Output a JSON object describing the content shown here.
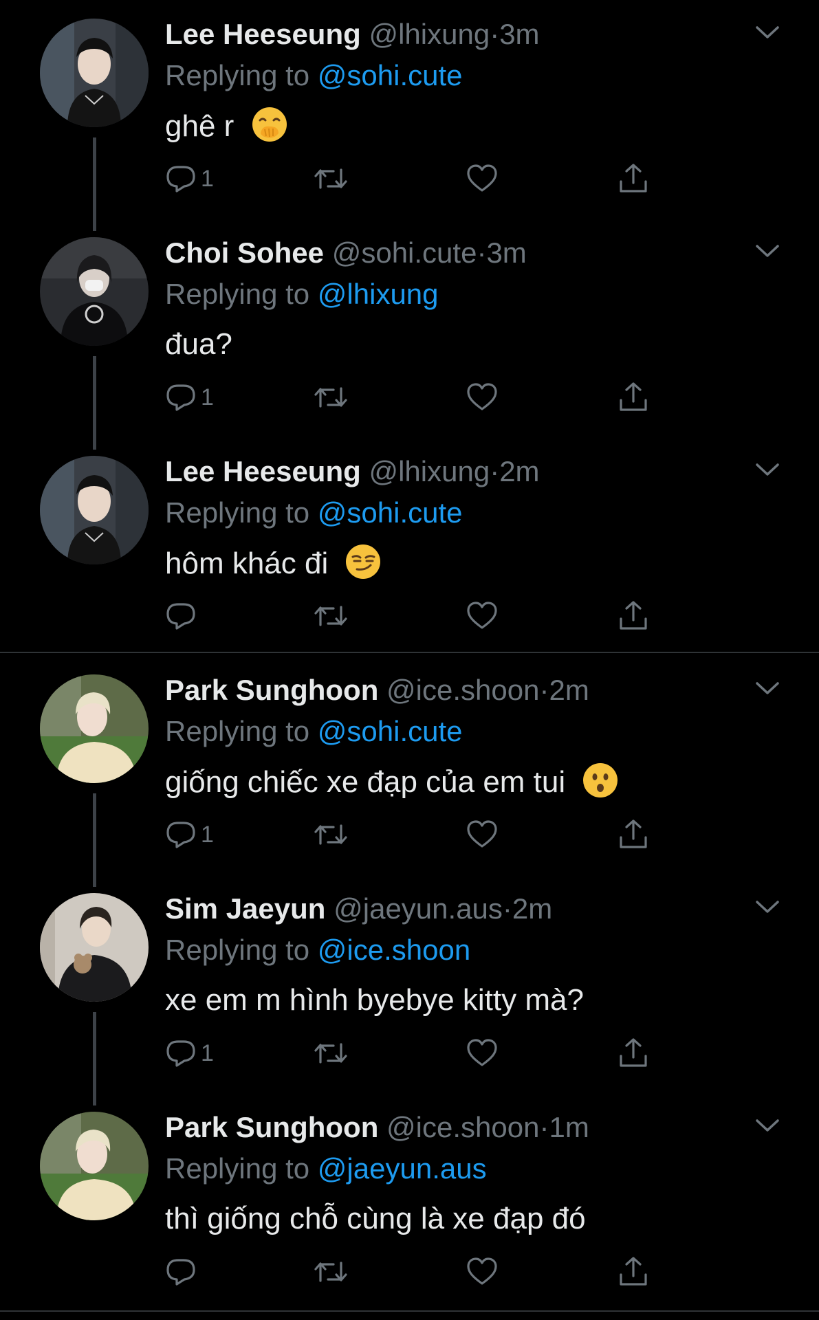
{
  "tweets": [
    {
      "name": "Lee Heeseung",
      "handle": "@lhixung",
      "dot": "·",
      "time": "3m",
      "replying_prefix": "Replying to ",
      "replying_to": "@sohi.cute",
      "text": "ghê r",
      "emoji": "face-with-hand-over-mouth",
      "reply_count": "1",
      "avatar_color": "#3a3f46"
    },
    {
      "name": "Choi Sohee",
      "handle": "@sohi.cute",
      "dot": "·",
      "time": "3m",
      "replying_prefix": "Replying to ",
      "replying_to": "@lhixung",
      "text": "đua?",
      "reply_count": "1",
      "avatar_color": "#2a2c30"
    },
    {
      "name": "Lee Heeseung",
      "handle": "@lhixung",
      "dot": "·",
      "time": "2m",
      "replying_prefix": "Replying to ",
      "replying_to": "@sohi.cute",
      "text": "hôm khác đi",
      "emoji": "smirking-face",
      "reply_count": "",
      "avatar_color": "#3a3f46"
    },
    {
      "name": "Park Sunghoon",
      "handle": "@ice.shoon",
      "dot": "·",
      "time": "2m",
      "replying_prefix": "Replying to ",
      "replying_to": "@sohi.cute",
      "text": "giống chiếc xe đạp của em tui",
      "emoji": "hushed-face",
      "reply_count": "1",
      "avatar_color": "#6b7a52"
    },
    {
      "name": "Sim Jaeyun",
      "handle": "@jaeyun.aus",
      "dot": "·",
      "time": "2m",
      "replying_prefix": "Replying to ",
      "replying_to": "@ice.shoon",
      "text": "xe em m hình byebye kitty mà?",
      "reply_count": "1",
      "avatar_color": "#c9c4bd"
    },
    {
      "name": "Park Sunghoon",
      "handle": "@ice.shoon",
      "dot": "·",
      "time": "1m",
      "replying_prefix": "Replying to ",
      "replying_to": "@jaeyun.aus",
      "text": "thì giống chỗ cùng là xe đạp đó",
      "reply_count": "",
      "avatar_color": "#6b7a52"
    }
  ],
  "colors": {
    "background": "#000000",
    "name": "#e7e9ea",
    "secondary": "#6e767d",
    "accent": "#1d9bf0",
    "thread_line": "#3d4248"
  }
}
